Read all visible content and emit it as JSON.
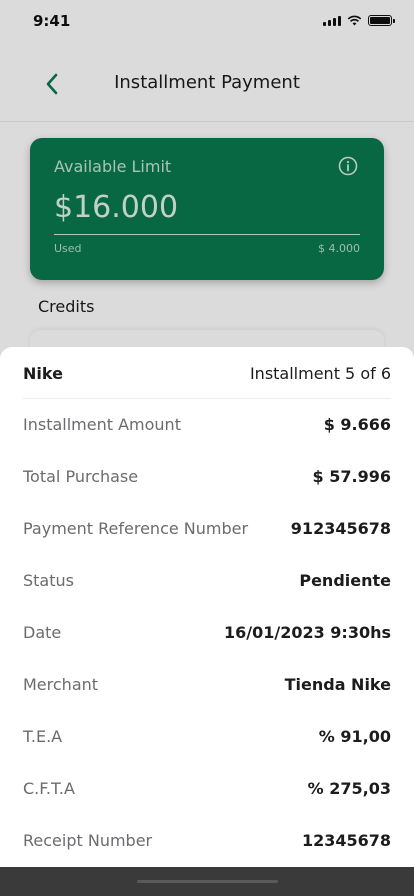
{
  "status_bar": {
    "time": "9:41"
  },
  "header": {
    "title": "Installment Payment"
  },
  "limit_card": {
    "label": "Available Limit",
    "amount": "$16.000",
    "used_label": "Used",
    "used_value": "$ 4.000",
    "color": "#0a7a4e"
  },
  "credits": {
    "title": "Credits"
  },
  "sheet": {
    "merchant": "Nike",
    "installment": "Installment 5 of 6",
    "rows": [
      {
        "label": "Installment Amount",
        "value": "$ 9.666"
      },
      {
        "label": "Total Purchase",
        "value": "$ 57.996"
      },
      {
        "label": "Payment Reference Number",
        "value": "912345678"
      },
      {
        "label": "Status",
        "value": "Pendiente"
      },
      {
        "label": "Date",
        "value": "16/01/2023 9:30hs"
      },
      {
        "label": "Merchant",
        "value": "Tienda Nike"
      },
      {
        "label": "T.E.A",
        "value": "% 91,00"
      },
      {
        "label": "C.F.T.A",
        "value": "% 275,03"
      },
      {
        "label": "Receipt Number",
        "value": "12345678"
      }
    ]
  },
  "icons": {
    "back": "chevron-left-icon",
    "info": "info-icon",
    "signal": "signal-icon",
    "wifi": "wifi-icon",
    "battery": "battery-icon"
  }
}
